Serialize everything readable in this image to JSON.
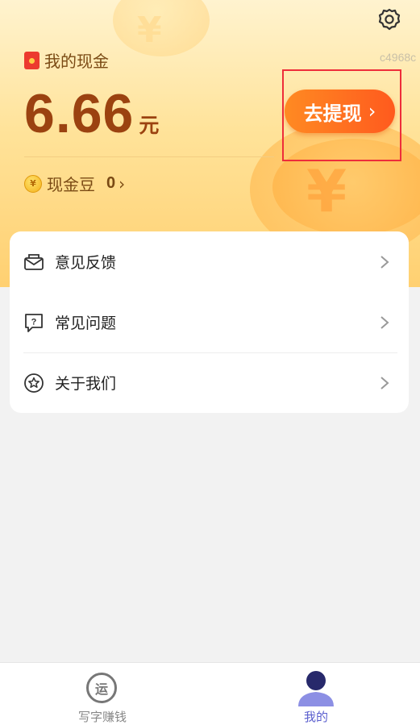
{
  "header": {
    "user_id": "c4968c",
    "cash_title": "我的现金",
    "balance": "6.66",
    "balance_unit": "元",
    "withdraw_label": "去提现",
    "beans_label": "现金豆",
    "beans_value": "0"
  },
  "menu": {
    "items": [
      {
        "label": "意见反馈",
        "icon": "feedback-mail-icon"
      },
      {
        "label": "常见问题",
        "icon": "faq-question-icon"
      },
      {
        "label": "关于我们",
        "icon": "about-star-icon"
      }
    ]
  },
  "tabbar": {
    "tabs": [
      {
        "label": "写字赚钱",
        "icon": "yun-circle-icon",
        "icon_text": "运",
        "active": false
      },
      {
        "label": "我的",
        "icon": "person-icon",
        "active": true
      }
    ]
  },
  "colors": {
    "accent": "#ff5a1e",
    "highlight_border": "#ee2d3a",
    "tab_active": "#5b5fce",
    "balance_text": "#9b4210"
  }
}
